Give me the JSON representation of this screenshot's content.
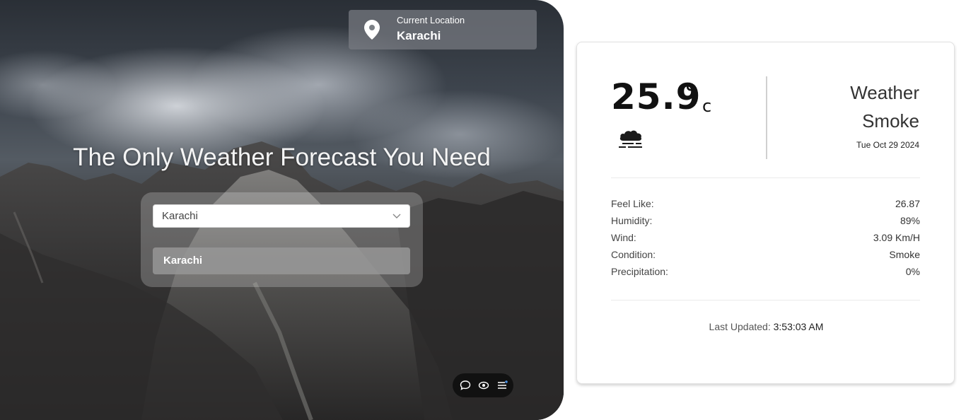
{
  "hero": {
    "title": "The Only Weather Forecast You Need",
    "current_location": {
      "label": "Current Location",
      "city": "Karachi",
      "icon": "location-pin-icon"
    },
    "search": {
      "selected_value": "Karachi",
      "options": [
        "Karachi"
      ]
    },
    "toolbar": {
      "icons": [
        "chat-icon",
        "eye-icon",
        "menu-list-icon"
      ]
    }
  },
  "weather_card": {
    "temperature": "25.9",
    "degree_symbol": "°",
    "unit": "c",
    "condition_icon": "cloud-fog-icon",
    "title": "Weather",
    "condition": "Smoke",
    "date": "Tue Oct 29 2024",
    "stats": [
      {
        "label": "Feel Like:",
        "value": "26.87"
      },
      {
        "label": "Humidity:",
        "value": "89%"
      },
      {
        "label": "Wind:",
        "value": "3.09 Km/H"
      },
      {
        "label": "Condition:",
        "value": "Smoke"
      },
      {
        "label": "Precipitation:",
        "value": "0%"
      }
    ],
    "last_updated_label": "Last Updated:",
    "last_updated_time": "3:53:03 AM"
  }
}
